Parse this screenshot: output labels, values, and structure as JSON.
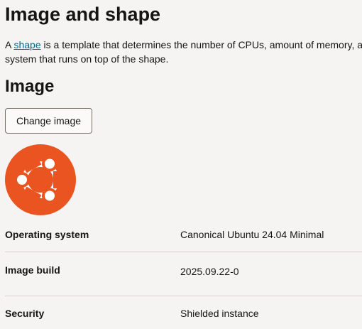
{
  "page": {
    "title": "Image and shape",
    "intro": {
      "prefix": "A ",
      "link_text": "shape",
      "rest_line1": " is a template that determines the number of CPUs, amount of memory, and",
      "line2": "system that runs on top of the shape."
    }
  },
  "image_section": {
    "title": "Image",
    "change_button_label": "Change image",
    "logo_icon": "ubuntu-logo-icon",
    "colors": {
      "logo_background": "#e95420",
      "logo_foreground": "#ffffff"
    },
    "details": [
      {
        "label": "Operating system",
        "value": "Canonical Ubuntu 24.04 Minimal"
      },
      {
        "label": "Image build",
        "value": "2025.09.22-0"
      },
      {
        "label": "Security",
        "value": "Shielded instance"
      }
    ]
  }
}
